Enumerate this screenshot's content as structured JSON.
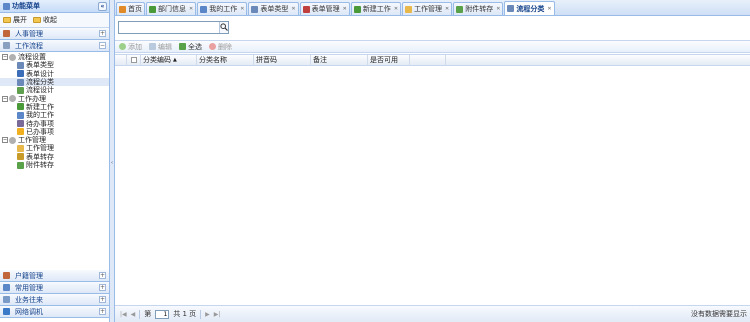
{
  "sidebar": {
    "title": "功能菜单",
    "expand_label": "展开",
    "collapse_label": "收起",
    "sections_top": [
      {
        "label": "人事管理",
        "toggle": "+"
      },
      {
        "label": "工作流程",
        "toggle": "−"
      }
    ],
    "tree": [
      {
        "label": "流程设置",
        "expander": "−",
        "level": 1,
        "icon_color": "#b0b0b0"
      },
      {
        "label": "表单类型",
        "level": 2,
        "icon_color": "#6a88b8"
      },
      {
        "label": "表单设计",
        "level": 2,
        "icon_color": "#3b6db8"
      },
      {
        "label": "流程分类",
        "level": 2,
        "icon_color": "#6a88b8",
        "selected": true
      },
      {
        "label": "流程设计",
        "level": 2,
        "icon_color": "#5fa04e"
      },
      {
        "label": "工作办理",
        "expander": "−",
        "level": 1,
        "icon_color": "#b0b0b0"
      },
      {
        "label": "新建工作",
        "level": 2,
        "icon_color": "#4a9a3a"
      },
      {
        "label": "我的工作",
        "level": 2,
        "icon_color": "#5b87c8"
      },
      {
        "label": "待办事项",
        "level": 2,
        "icon_color": "#7a6a9a"
      },
      {
        "label": "已办事项",
        "level": 2,
        "icon_color": "#f0b020"
      },
      {
        "label": "工作管理",
        "expander": "−",
        "level": 1,
        "icon_color": "#b0b0b0"
      },
      {
        "label": "工作管理",
        "level": 2,
        "icon_color": "#e8b84a"
      },
      {
        "label": "表单转存",
        "level": 2,
        "icon_color": "#c89a2a"
      },
      {
        "label": "附件转存",
        "level": 2,
        "icon_color": "#5aa24a"
      }
    ],
    "sections_bottom": [
      {
        "label": "户籍管理",
        "toggle": "+",
        "icon_color": "#c0663a"
      },
      {
        "label": "常用管理",
        "toggle": "+",
        "icon_color": "#5b87c8"
      },
      {
        "label": "业务往来",
        "toggle": "+",
        "icon_color": "#7a9ac8"
      },
      {
        "label": "网络调机",
        "toggle": "+",
        "icon_color": "#3a7ac8"
      }
    ]
  },
  "tabs": [
    {
      "label": "首页",
      "icon_color": "#e08a2a",
      "closable": false
    },
    {
      "label": "部门信息",
      "icon_color": "#4a9a3a",
      "closable": true
    },
    {
      "label": "我的工作",
      "icon_color": "#5b87c8",
      "closable": true
    },
    {
      "label": "表单类型",
      "icon_color": "#6a88b8",
      "closable": true
    },
    {
      "label": "表单管理",
      "icon_color": "#c04040",
      "closable": true
    },
    {
      "label": "新建工作",
      "icon_color": "#4a9a3a",
      "closable": true
    },
    {
      "label": "工作管理",
      "icon_color": "#e8b84a",
      "closable": true
    },
    {
      "label": "附件转存",
      "icon_color": "#5aa24a",
      "closable": true
    },
    {
      "label": "流程分类",
      "icon_color": "#6a88b8",
      "closable": true,
      "active": true
    }
  ],
  "search": {
    "value": "",
    "placeholder": ""
  },
  "toolbar": {
    "add_label": "添加",
    "edit_label": "编辑",
    "selectall_label": "全选",
    "delete_label": "删除"
  },
  "grid": {
    "columns": [
      "分类编码",
      "分类名称",
      "拼音码",
      "备注",
      "是否可用"
    ],
    "sort_indicator": "▲",
    "rows": []
  },
  "pager": {
    "page_label": "第",
    "page_value": "1",
    "total_label": "共 1 页",
    "message": "没有数据需要显示"
  }
}
